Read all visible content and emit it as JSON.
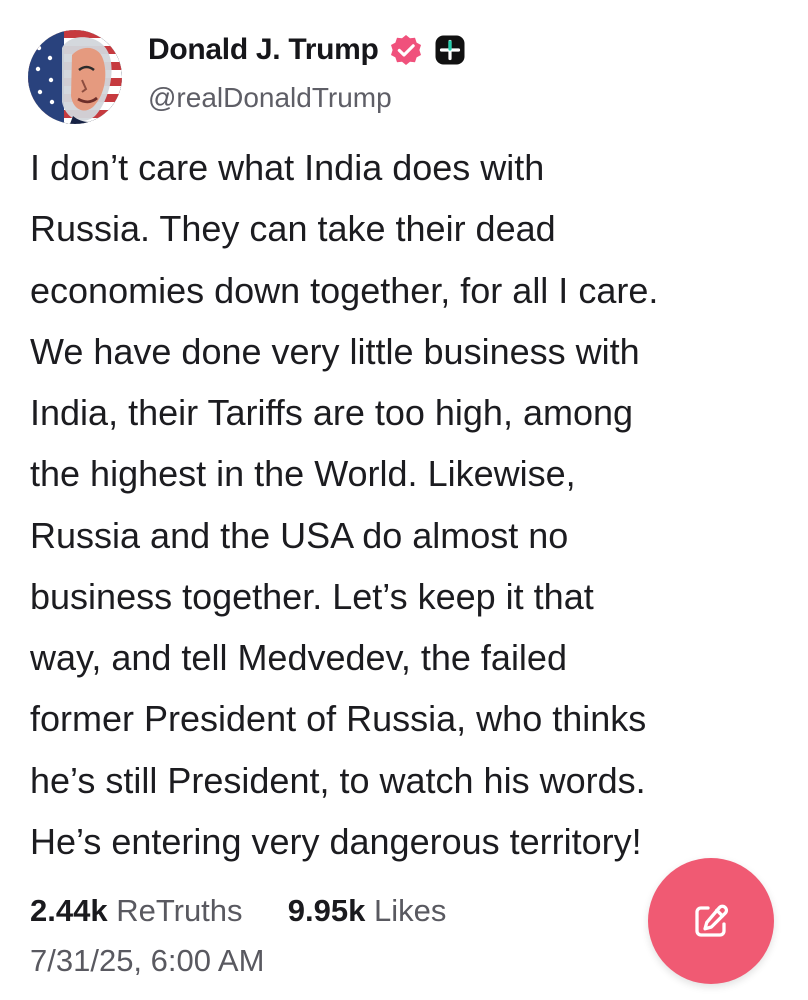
{
  "post": {
    "author": {
      "display_name": "Donald J. Trump",
      "handle": "@realDonaldTrump",
      "verified_icon": "verified-badge-icon",
      "app_badge_icon": "app-badge-icon"
    },
    "body_lines": [
      "I don’t care what India does with",
      "Russia. They can take their dead",
      "economies down together, for all I care.",
      "We have done very little business with",
      "India, their Tariffs are too high, among",
      "the highest in the World. Likewise,",
      "Russia and the USA do almost no",
      "business together. Let’s keep it that",
      "way, and tell Medvedev, the failed",
      "former President of Russia, who thinks",
      "he’s still President, to watch his words.",
      "He’s entering very dangerous territory!"
    ],
    "stats": {
      "retruths_count": "2.44k",
      "retruths_label": "ReTruths",
      "likes_count": "9.95k",
      "likes_label": "Likes"
    },
    "timestamp": "7/31/25, 6:00 AM"
  },
  "compose": {
    "icon": "pencil-square-icon",
    "color": "#F05A73"
  },
  "colors": {
    "verified": "#F0517C",
    "app_badge": "#111111",
    "text": "#1C1C20",
    "muted": "#595960"
  }
}
